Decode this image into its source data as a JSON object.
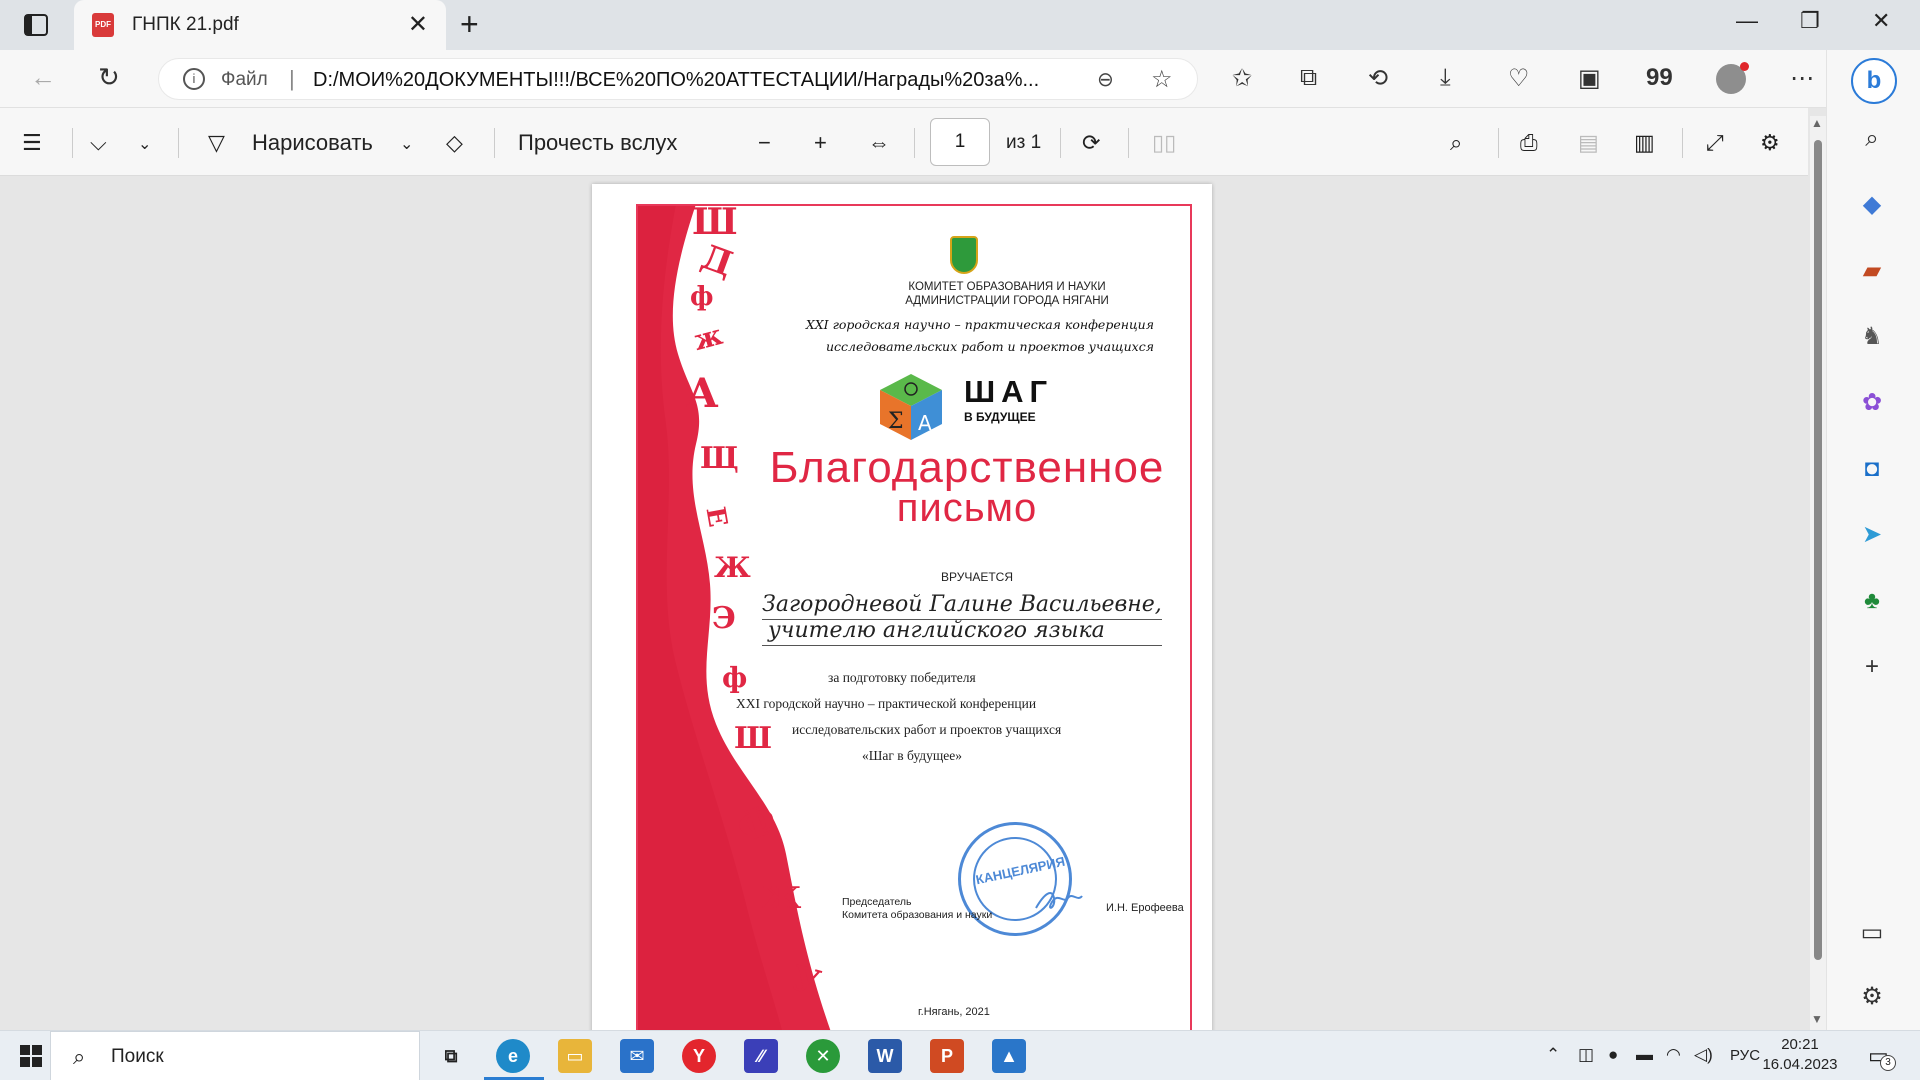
{
  "browser": {
    "tab_title": "ГНПК 21.pdf",
    "tab_favicon_label": "PDF",
    "url_scheme_label": "Файл",
    "url": "D:/МОИ%20ДОКУМЕНТЫ!!!/ВСЕ%20ПО%20АТТЕСТАЦИИ/Награды%20за%...",
    "extension_count_label": "99"
  },
  "pdf_toolbar": {
    "draw_label": "Нарисовать",
    "read_aloud_label": "Прочесть вслух",
    "page_current": "1",
    "page_total_label": "из 1"
  },
  "certificate": {
    "committee_line1": "КОМИТЕТ ОБРАЗОВАНИЯ И НАУКИ",
    "committee_line2": "АДМИНИСТРАЦИИ ГОРОДА НЯГАНИ",
    "conf_line1": "XXI городская научно – практическая конференция",
    "conf_line2": "исследовательских работ и проектов учащихся",
    "logo_title": "ШАГ",
    "logo_subtitle": "В БУДУЩЕЕ",
    "title_line1": "Благодарственное",
    "title_line2": "письмо",
    "handed_label": "ВРУЧАЕТСЯ",
    "recipient_line1": "Загородневой Галине Васильевне,",
    "recipient_line2": "учителю английского языка",
    "reason_line1": "за подготовку победителя",
    "reason_line2": "XXI городской научно – практической конференции",
    "reason_line3": "исследовательских работ и проектов учащихся",
    "reason_line4": "«Шаг в будущее»",
    "stamp_text": "КАНЦЕЛЯРИЯ",
    "signer_title_line1": "Председатель",
    "signer_title_line2": "Комитета образования и науки",
    "signer_name": "И.Н. Ерофеева",
    "city_year": "г.Нягань, 2021"
  },
  "taskbar": {
    "search_label": "Поиск",
    "lang": "РУС",
    "time": "20:21",
    "date": "16.04.2023",
    "notification_count": "3"
  },
  "colors": {
    "accent_red": "#e02744",
    "stamp_blue": "#4d89d6",
    "taskbar_active": "#2a7dd2"
  }
}
